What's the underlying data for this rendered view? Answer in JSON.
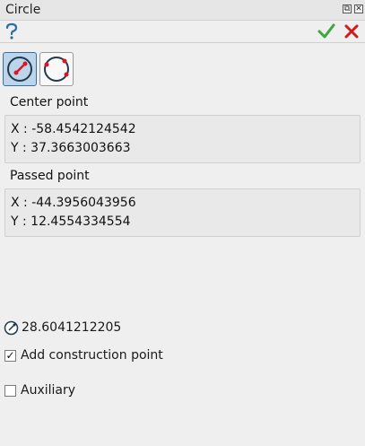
{
  "window": {
    "title": "Circle",
    "restore_glyph": "⧉",
    "close_glyph": "✕"
  },
  "toolbar": {
    "help_icon": "question-icon",
    "ok_icon": "checkmark-icon",
    "cancel_icon": "x-icon"
  },
  "modes": [
    {
      "name": "center-and-point",
      "icon": "circle-center-radius-icon",
      "active": true
    },
    {
      "name": "three-points",
      "icon": "circle-three-points-icon",
      "active": false
    }
  ],
  "center_point": {
    "label": "Center point",
    "x": "X : -58.4542124542",
    "y": "Y : 37.3663003663"
  },
  "passed_point": {
    "label": "Passed point",
    "x": "X : -44.3956043956",
    "y": "Y : 12.4554334554"
  },
  "radius": {
    "icon": "radius-icon",
    "value": "28.6041212205"
  },
  "options": {
    "construction_point": {
      "label": "Add construction point",
      "checked": true
    },
    "auxiliary": {
      "label": "Auxiliary",
      "checked": false
    }
  },
  "colors": {
    "accent_red": "#e0141e",
    "ok_green": "#3aa83a",
    "active_mode": "#bcd5ea",
    "help_blue": "#2c6e9e"
  }
}
